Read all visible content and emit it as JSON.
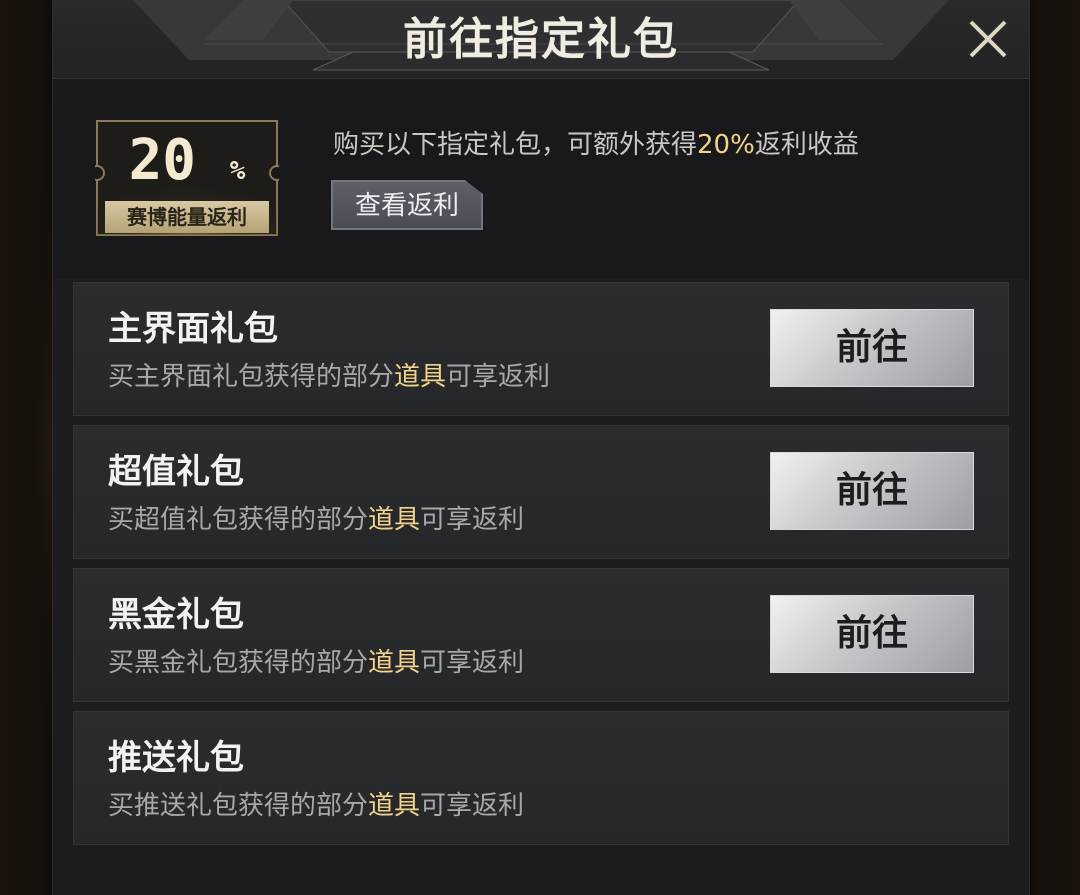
{
  "dialog": {
    "title": "前往指定礼包",
    "close_icon": "close-icon"
  },
  "banner": {
    "badge_percent": "20",
    "badge_percent_sign": "%",
    "badge_label": "赛博能量返利",
    "desc_prefix": "购买以下指定礼包，可额外获得",
    "desc_highlight": "20%",
    "desc_suffix": "返利收益",
    "view_rebate_label": "查看返利",
    "highlight_color": "#f1d48a"
  },
  "packages": [
    {
      "title": "主界面礼包",
      "sub_prefix": "买主界面礼包获得的部分",
      "sub_highlight": "道具",
      "sub_suffix": "可享返利",
      "button_label": "前往"
    },
    {
      "title": "超值礼包",
      "sub_prefix": "买超值礼包获得的部分",
      "sub_highlight": "道具",
      "sub_suffix": "可享返利",
      "button_label": "前往"
    },
    {
      "title": "黑金礼包",
      "sub_prefix": "买黑金礼包获得的部分",
      "sub_highlight": "道具",
      "sub_suffix": "可享返利",
      "button_label": "前往"
    },
    {
      "title": "推送礼包",
      "sub_prefix": "买推送礼包获得的部分",
      "sub_highlight": "道具",
      "sub_suffix": "可享返利"
    }
  ]
}
